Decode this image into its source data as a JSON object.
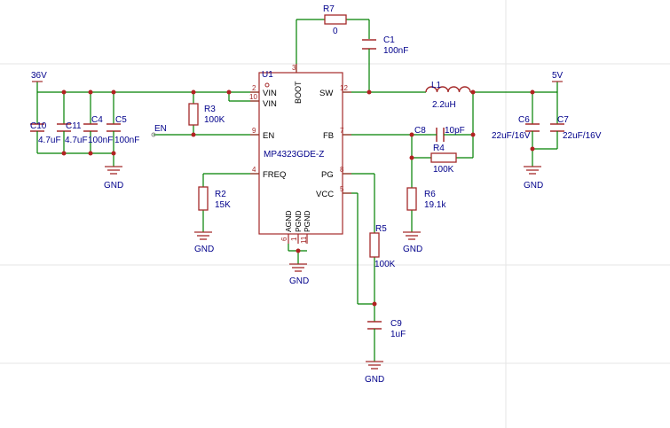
{
  "ic": {
    "ref": "U1",
    "part": "MP4323GDE-Z",
    "pins": {
      "vin2_num": "2",
      "vin2": "VIN",
      "vin10_num": "10",
      "vin10": "VIN",
      "en_num": "9",
      "en": "EN",
      "freq_num": "4",
      "freq": "FREQ",
      "boot_num": "3",
      "boot": "BOOT",
      "sw_num": "12",
      "sw": "SW",
      "fb_num": "7",
      "fb": "FB",
      "pg_num": "8",
      "pg": "PG",
      "vcc_num": "5",
      "vcc": "VCC",
      "agnd": "AGND",
      "pgnd1": "PGND",
      "pgnd2": "PGND",
      "agnd_num": "6",
      "pgnd1_num": "1",
      "pgnd2_num": "11"
    }
  },
  "nets": {
    "vin": "36V",
    "vout": "5V",
    "en": "EN",
    "gnd": "GND"
  },
  "components": {
    "c10": {
      "ref": "C10",
      "value": "4.7uF"
    },
    "c11": {
      "ref": "C11",
      "value": "4.7uF"
    },
    "c4": {
      "ref": "C4",
      "value": "100nF"
    },
    "c5": {
      "ref": "C5",
      "value": "100nF"
    },
    "r3": {
      "ref": "R3",
      "value": "100K"
    },
    "r2": {
      "ref": "R2",
      "value": "15K"
    },
    "r7": {
      "ref": "R7",
      "value": "0"
    },
    "c1": {
      "ref": "C1",
      "value": "100nF"
    },
    "l1": {
      "ref": "L1",
      "value": "2.2uH"
    },
    "c8": {
      "ref": "C8",
      "value": "10pF"
    },
    "r4": {
      "ref": "R4",
      "value": "100K"
    },
    "r6": {
      "ref": "R6",
      "value": "19.1k"
    },
    "r5": {
      "ref": "R5",
      "value": "100K"
    },
    "c9": {
      "ref": "C9",
      "value": "1uF"
    },
    "c6": {
      "ref": "C6",
      "value": "22uF/16V"
    },
    "c7": {
      "ref": "C7",
      "value": "22uF/16V"
    }
  },
  "colors": {
    "wire": "#008000",
    "part": "#a52a2a",
    "label": "#00008b",
    "pin": "#a52a2a",
    "grid": "#e8e8e8",
    "junction": "#b22222"
  }
}
